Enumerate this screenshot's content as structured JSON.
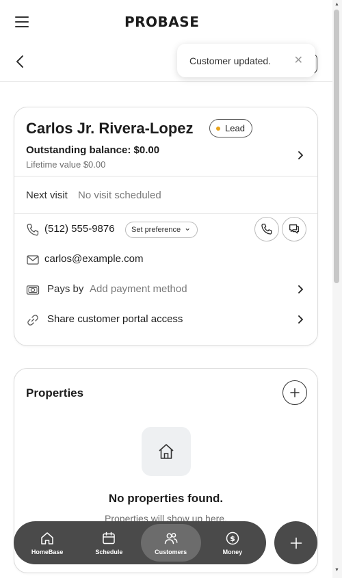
{
  "header": {
    "logo_text": "PROBASE",
    "menu_icon": "hamburger-icon",
    "back_icon": "chevron-left-icon"
  },
  "toast": {
    "message": "Customer updated.",
    "close_icon": "close-icon"
  },
  "customer": {
    "name": "Carlos Jr. Rivera-Lopez",
    "status_badge": "Lead",
    "status_color": "#e9a31a",
    "outstanding_balance": "Outstanding balance: $0.00",
    "lifetime_value": "Lifetime value $0.00",
    "next_visit_label": "Next visit",
    "next_visit_value": "No visit scheduled",
    "phone": "(512) 555-9876",
    "set_preference_label": "Set preference",
    "email": "carlos@example.com",
    "pays_by_label": "Pays by",
    "pays_by_value": "Add payment method",
    "portal_label": "Share customer portal access"
  },
  "properties": {
    "title": "Properties",
    "empty_title": "No properties found.",
    "empty_subtitle": "Properties will show up here."
  },
  "nav": {
    "items": [
      {
        "label": "HomeBase",
        "icon": "home-icon"
      },
      {
        "label": "Schedule",
        "icon": "calendar-icon"
      },
      {
        "label": "Customers",
        "icon": "users-icon",
        "active": true
      },
      {
        "label": "Money",
        "icon": "dollar-icon"
      }
    ],
    "fab_icon": "plus-icon"
  },
  "colors": {
    "nav_bg": "#4a4a4a",
    "nav_active": "#6c6c6c",
    "accent_dot": "#e9a31a"
  }
}
